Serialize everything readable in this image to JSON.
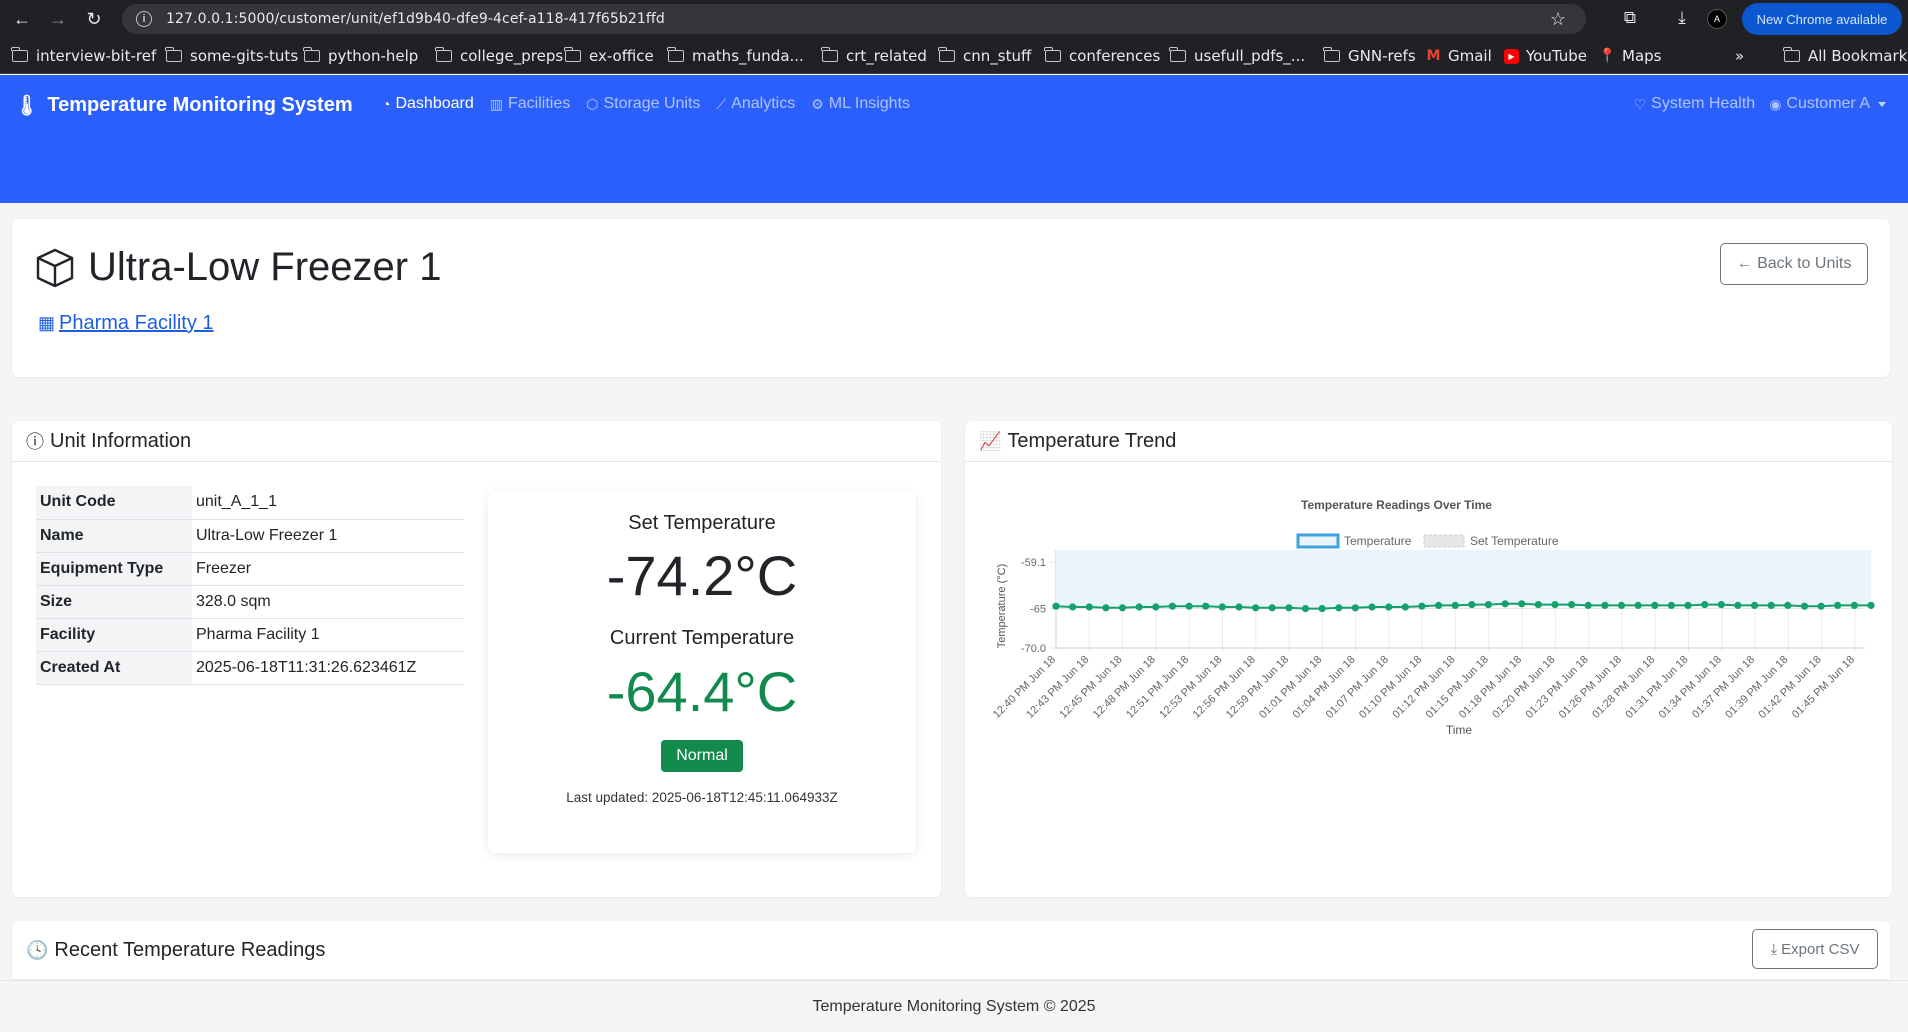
{
  "browser": {
    "url": "127.0.0.1:5000/customer/unit/ef1d9b40-dfe9-4cef-a118-417f65b21ffd",
    "new_chrome": "New Chrome available",
    "profile_initial": "A",
    "bookmarks": [
      {
        "label": "interview-bit-ref",
        "type": "folder"
      },
      {
        "label": "some-gits-tuts",
        "type": "folder"
      },
      {
        "label": "python-help",
        "type": "folder"
      },
      {
        "label": "college_preps",
        "type": "folder"
      },
      {
        "label": "ex-office",
        "type": "folder"
      },
      {
        "label": "maths_funda...",
        "type": "folder"
      },
      {
        "label": "crt_related",
        "type": "folder"
      },
      {
        "label": "cnn_stuff",
        "type": "folder"
      },
      {
        "label": "conferences",
        "type": "folder"
      },
      {
        "label": "usefull_pdfs_...",
        "type": "folder"
      },
      {
        "label": "GNN-refs",
        "type": "folder"
      },
      {
        "label": "Gmail",
        "type": "gmail"
      },
      {
        "label": "YouTube",
        "type": "youtube"
      },
      {
        "label": "Maps",
        "type": "maps"
      }
    ],
    "all_bookmarks": "All Bookmarks"
  },
  "navbar": {
    "brand": "Temperature Monitoring System",
    "links": [
      {
        "label": "Dashboard",
        "icon": "speedometer-icon",
        "active": true
      },
      {
        "label": "Facilities",
        "icon": "building-icon",
        "active": false
      },
      {
        "label": "Storage Units",
        "icon": "box-icon",
        "active": false
      },
      {
        "label": "Analytics",
        "icon": "graph-icon",
        "active": false
      },
      {
        "label": "ML Insights",
        "icon": "cpu-icon",
        "active": false
      }
    ],
    "system_health": "System Health",
    "user": "Customer A"
  },
  "header": {
    "title": "Ultra-Low Freezer 1",
    "facility_link": "Pharma Facility 1",
    "back_button": "← Back to Units"
  },
  "unit_info": {
    "title": "Unit Information",
    "rows": [
      {
        "key": "Unit Code",
        "value": "unit_A_1_1"
      },
      {
        "key": "Name",
        "value": "Ultra-Low Freezer 1"
      },
      {
        "key": "Equipment Type",
        "value": "Freezer"
      },
      {
        "key": "Size",
        "value": "328.0 sqm"
      },
      {
        "key": "Facility",
        "value": "Pharma Facility 1"
      },
      {
        "key": "Created At",
        "value": "2025-06-18T11:31:26.623461Z"
      }
    ],
    "set_temp_label": "Set Temperature",
    "set_temp_value": "-74.2°C",
    "current_temp_label": "Current Temperature",
    "current_temp_value": "-64.4°C",
    "status": "Normal",
    "last_updated": "Last updated: 2025-06-18T12:45:11.064933Z",
    "colors": {
      "current": "#138a4d",
      "badge": "#138a4d"
    }
  },
  "trend": {
    "title": "Temperature Trend"
  },
  "chart_data": {
    "type": "line",
    "title": "Temperature Readings Over Time",
    "xlabel": "Time",
    "ylabel": "Temperature (°C)",
    "y_ticks": [
      "-59.1",
      "-65",
      "-70.0"
    ],
    "y_tick_values": [
      -59.1,
      -65,
      -70.0
    ],
    "ylim": [
      -70.0,
      -59.1
    ],
    "grid": true,
    "legend_position": "top",
    "x_tick_labels": [
      "12:40 PM Jun 18",
      "12:43 PM Jun 18",
      "12:45 PM Jun 18",
      "12:48 PM Jun 18",
      "12:51 PM Jun 18",
      "12:53 PM Jun 18",
      "12:56 PM Jun 18",
      "12:59 PM Jun 18",
      "01:01 PM Jun 18",
      "01:04 PM Jun 18",
      "01:07 PM Jun 18",
      "01:10 PM Jun 18",
      "01:12 PM Jun 18",
      "01:15 PM Jun 18",
      "01:18 PM Jun 18",
      "01:20 PM Jun 18",
      "01:23 PM Jun 18",
      "01:26 PM Jun 18",
      "01:28 PM Jun 18",
      "01:31 PM Jun 18",
      "01:34 PM Jun 18",
      "01:37 PM Jun 18",
      "01:39 PM Jun 18",
      "01:42 PM Jun 18",
      "01:45 PM Jun 18"
    ],
    "series": [
      {
        "name": "Temperature",
        "color": "#3ea3e0",
        "point_color": "#16a06a",
        "values": [
          -64.7,
          -64.8,
          -64.8,
          -64.9,
          -64.9,
          -64.8,
          -64.8,
          -64.7,
          -64.7,
          -64.7,
          -64.8,
          -64.8,
          -64.9,
          -64.9,
          -64.9,
          -65.0,
          -65.0,
          -64.9,
          -64.9,
          -64.8,
          -64.8,
          -64.8,
          -64.7,
          -64.6,
          -64.6,
          -64.5,
          -64.5,
          -64.4,
          -64.4,
          -64.5,
          -64.5,
          -64.5,
          -64.6,
          -64.6,
          -64.6,
          -64.6,
          -64.6,
          -64.6,
          -64.6,
          -64.5,
          -64.5,
          -64.6,
          -64.6,
          -64.6,
          -64.6,
          -64.7,
          -64.7,
          -64.6,
          -64.6,
          -64.6
        ],
        "fill": "#eaf4fd"
      },
      {
        "name": "Set Temperature",
        "color": "#cfcfcf",
        "values": []
      }
    ]
  },
  "readings": {
    "title": "Recent Temperature Readings",
    "export": "Export CSV"
  },
  "footer": "Temperature Monitoring System © 2025"
}
